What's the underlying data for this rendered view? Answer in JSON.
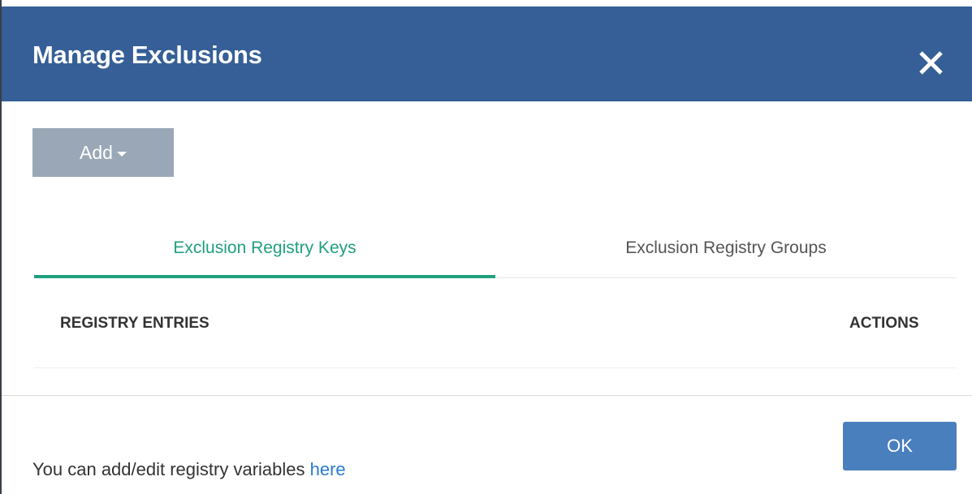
{
  "dialog": {
    "title": "Manage Exclusions",
    "close_icon": "close-icon"
  },
  "toolbar": {
    "add_label": "Add",
    "add_caret_icon": "caret-down-icon"
  },
  "tabs": [
    {
      "label": "Exclusion Registry Keys",
      "active": true
    },
    {
      "label": "Exclusion Registry Groups",
      "active": false
    }
  ],
  "table": {
    "columns": [
      "REGISTRY ENTRIES",
      "ACTIONS"
    ],
    "rows": []
  },
  "footer": {
    "text": "You can add/edit registry variables ",
    "link_text": "here",
    "ok_label": "OK"
  },
  "colors": {
    "header": "#355f96",
    "accent": "#1fa07e",
    "add_button": "#9aa7b6",
    "ok_button": "#4a7fbd",
    "link": "#2b7cd3"
  }
}
